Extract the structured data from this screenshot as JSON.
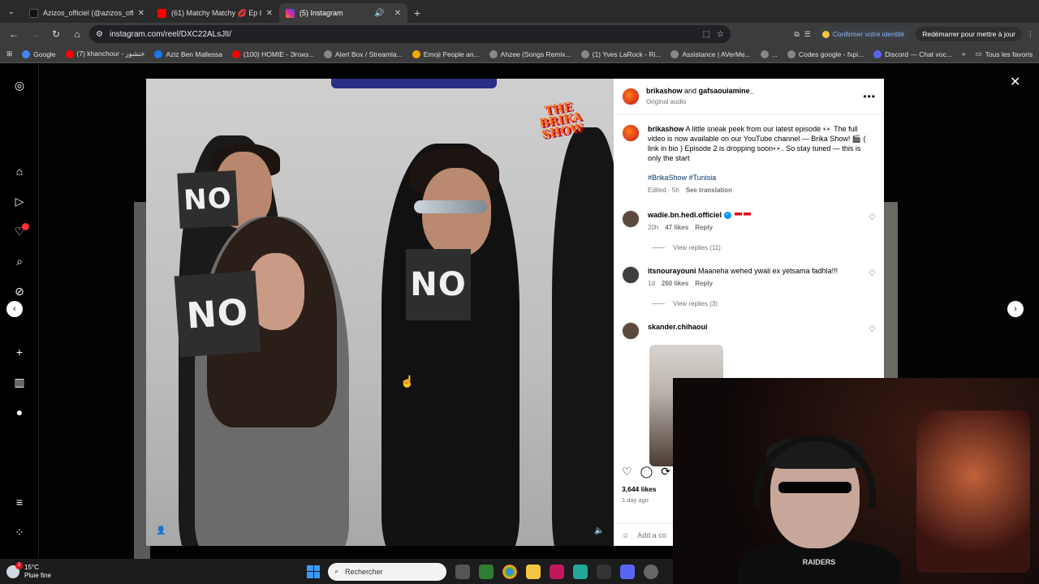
{
  "browser": {
    "tabs": [
      {
        "title": "Azizos_officiel (@azizos_officie",
        "color": "#111111"
      },
      {
        "title": "(61) Matchy Matchy 💋 Ep 85",
        "color": "#ff0000"
      },
      {
        "title": "(5) Instagram",
        "color": "#d6249f",
        "active": true
      }
    ],
    "url": "instagram.com/reel/DXC22ALsJlI/",
    "identity_label": "Confirmer votre identité",
    "restart_label": "Redémarrer pour mettre à jour",
    "bookmarks": [
      {
        "label": "Google",
        "color": "#4285f4"
      },
      {
        "label": "(7) khanchour - خنشور",
        "color": "#ff0000"
      },
      {
        "label": "Aziz Ben Mallessa",
        "color": "#1877f2"
      },
      {
        "label": "(100) HOMIE - Эгоиз...",
        "color": "#ff0000"
      },
      {
        "label": "Alert Box / Streamla...",
        "color": "#888888"
      },
      {
        "label": "Emoji People an...",
        "color": "#f2a900"
      },
      {
        "label": "Ahzee (Songs Remix...",
        "color": "#888888"
      },
      {
        "label": "(1) Yves LaRock - Ri...",
        "color": "#888888"
      },
      {
        "label": "Assistance | AVerMe...",
        "color": "#888888"
      },
      {
        "label": "...",
        "color": "#888888"
      },
      {
        "label": "Codes google - fxpi...",
        "color": "#888888"
      },
      {
        "label": "Discord — Chat voc...",
        "color": "#5865f2"
      }
    ],
    "all_bookmarks_label": "Tous les favoris"
  },
  "video": {
    "signs": [
      "NO",
      "NO",
      "NO"
    ],
    "logo_text": "THE BRIKA SHOW"
  },
  "panel": {
    "header_user": "brikashow",
    "header_and": "and",
    "header_collab": "gafsaouiamine_",
    "header_audio": "Original audio",
    "caption_user": "brikashow",
    "caption_text": "A little sneak peek from our latest episode 👀 The full video is now available on our YouTube channel — Brika Show! 🎬 ( link in bio ) Episode 2 is dropping soon👀. So stay tuned — this is only the start",
    "tags": "#BrikaShow #Tunisia",
    "caption_meta": "Edited · 5h",
    "see_translation": "See translation",
    "comments": [
      {
        "user": "wadie.bn.hedi.officiel",
        "text": "",
        "time": "20h",
        "likes": "47 likes",
        "reply": "Reply",
        "view_replies": "View replies (11)",
        "verified": true
      },
      {
        "user": "itsnourayouni",
        "text": "Maaneha wehed ywali ex yetsama fadhla!!!",
        "time": "1d",
        "likes": "260 likes",
        "reply": "Reply",
        "view_replies": "View replies (3)",
        "verified": false
      },
      {
        "user": "skander.chihaoui",
        "text": "",
        "time": "",
        "likes": "",
        "reply": "",
        "view_replies": "",
        "verified": false
      }
    ],
    "likes_count": "3,644 likes",
    "posted_ago": "1 day ago",
    "add_comment_placeholder": "Add a co"
  },
  "webcam": {
    "shirt_text": "RAIDERS"
  },
  "taskbar": {
    "temp": "15°C",
    "weather": "Pluie fine",
    "search_placeholder": "Rechercher"
  },
  "colors": {
    "accent": "#0095f6",
    "ig_link": "#00376b",
    "badge": "#ff3040"
  }
}
